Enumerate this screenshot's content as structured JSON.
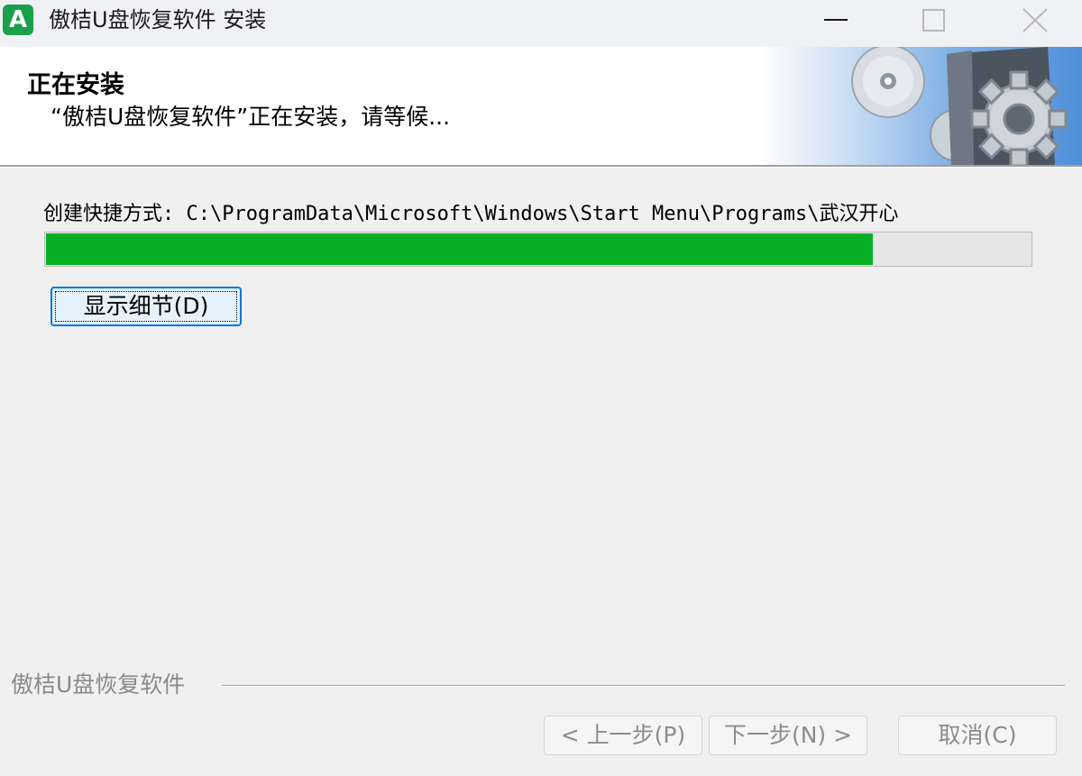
{
  "window": {
    "title": "傲桔U盘恢复软件 安装",
    "app_icon_letter": "A"
  },
  "header": {
    "title": "正在安装",
    "subtitle": "“傲桔U盘恢复软件”正在安装，请等候..."
  },
  "body": {
    "status_text": "创建快捷方式: C:\\ProgramData\\Microsoft\\Windows\\Start Menu\\Programs\\武汉开心",
    "progress_fraction": 0.84,
    "details_button_label": "显示细节(D)"
  },
  "footer": {
    "brand_label": "傲桔U盘恢复软件",
    "back_label": "< 上一步(P)",
    "next_label": "下一步(N) >",
    "cancel_label": "取消(C)"
  },
  "colors": {
    "progress_fill": "#06b025",
    "focus_border": "#0078d7",
    "app_icon": "#1aa04a"
  }
}
